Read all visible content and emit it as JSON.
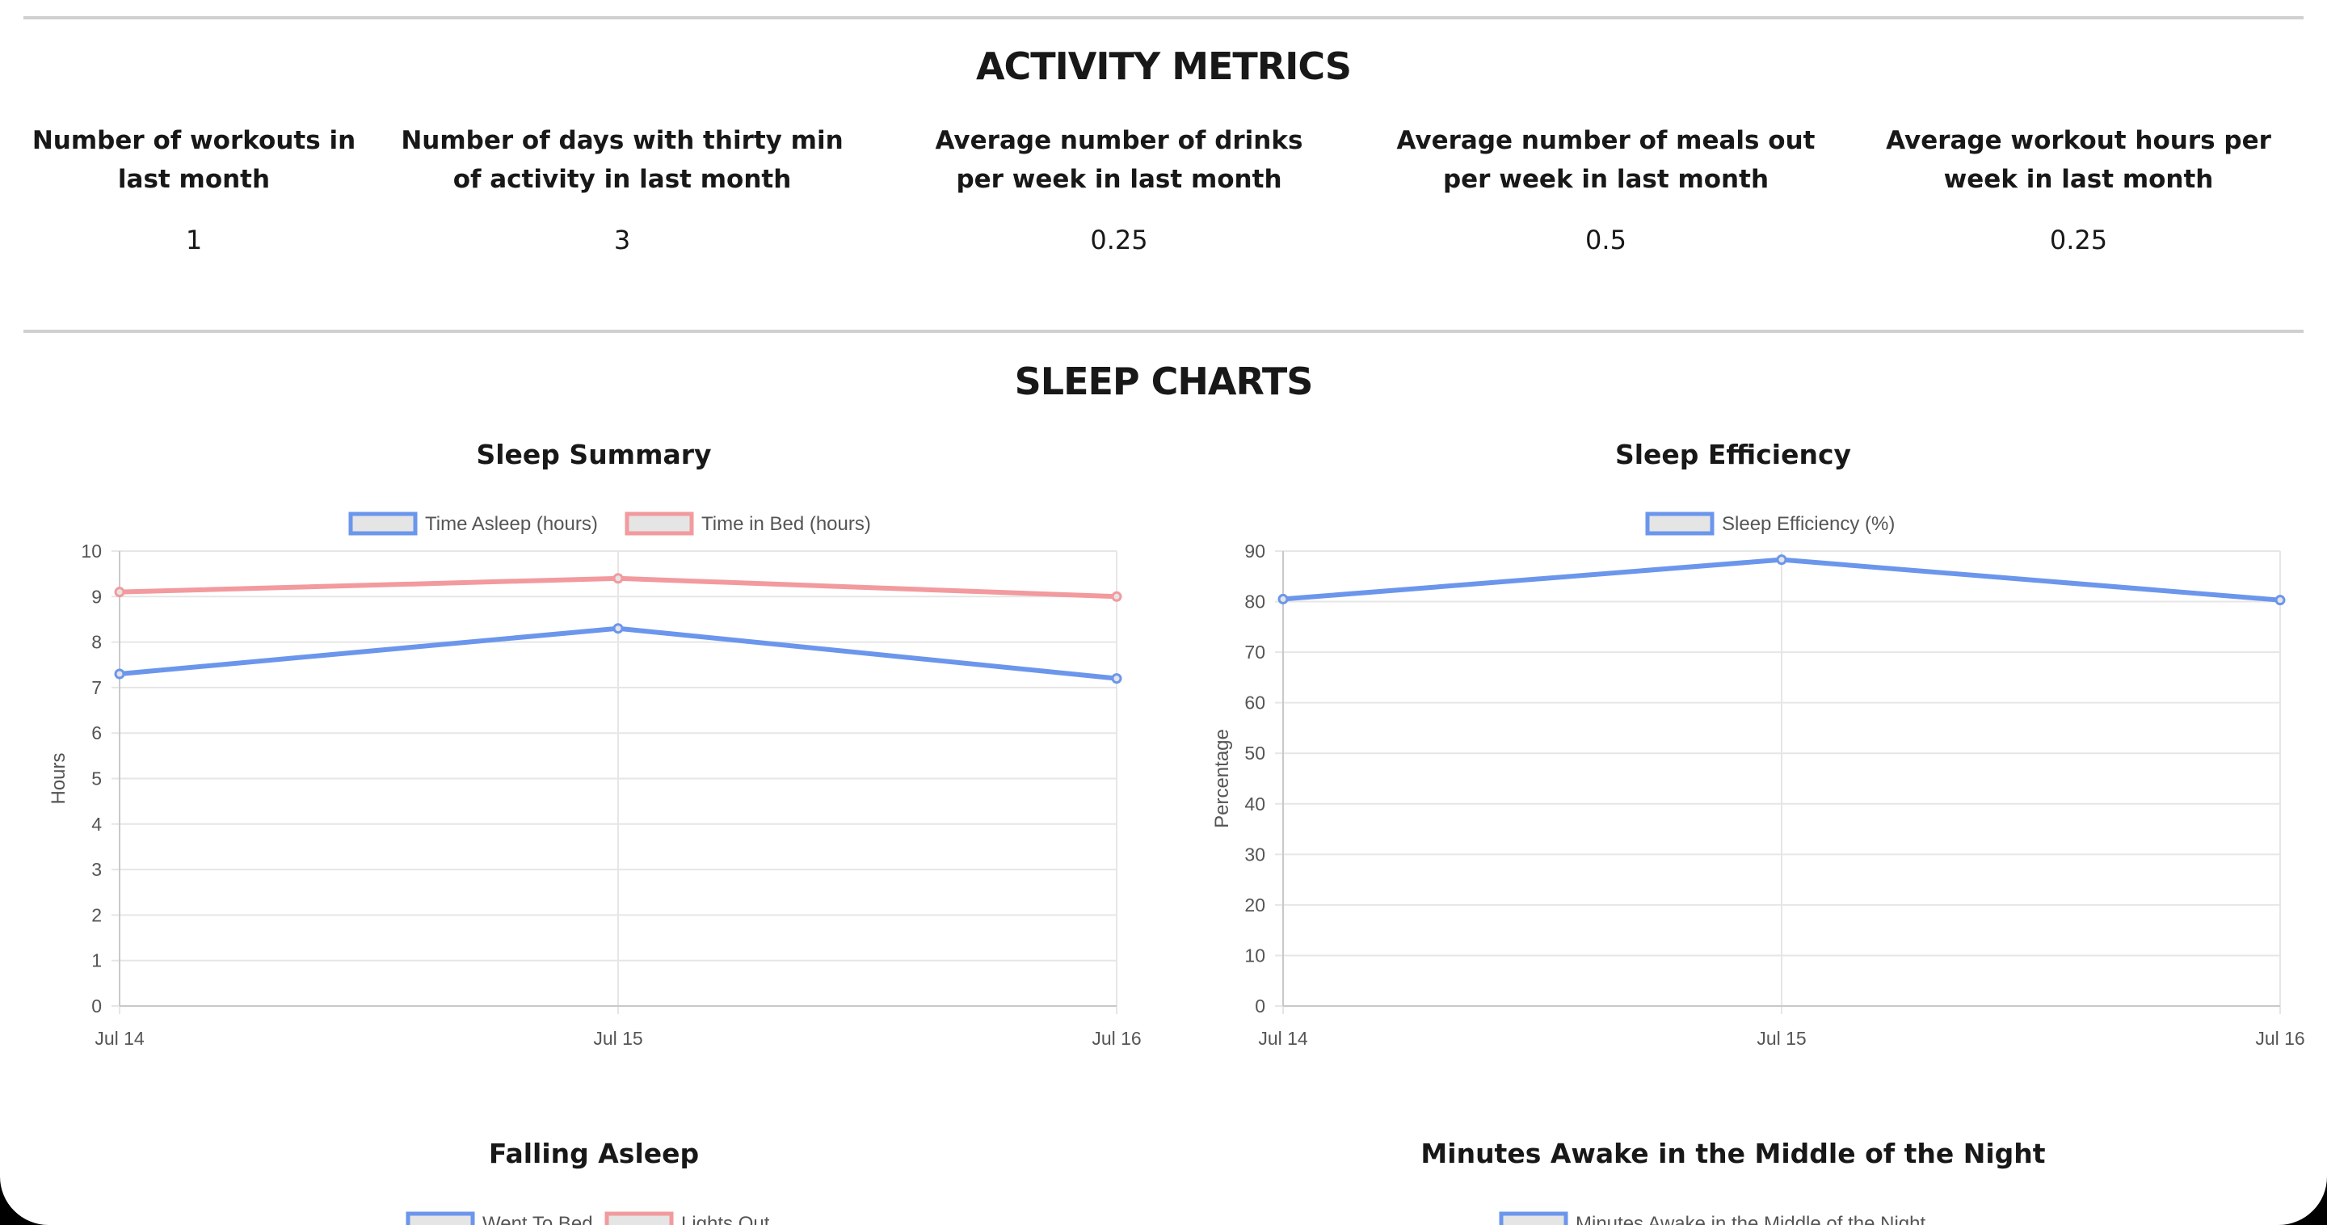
{
  "activity": {
    "title": "ACTIVITY METRICS",
    "metrics": [
      {
        "label": "Number of workouts in last month",
        "value": "1"
      },
      {
        "label": "Number of days with thirty min of activity in last month",
        "value": "3"
      },
      {
        "label": "Average number of drinks per week in last month",
        "value": "0.25"
      },
      {
        "label": "Average number of meals out per week in last month",
        "value": "0.5"
      },
      {
        "label": "Average workout hours per week in last month",
        "value": "0.25"
      }
    ]
  },
  "sleep": {
    "title": "SLEEP CHARTS",
    "falling_asleep": {
      "title": "Falling Asleep",
      "legend": [
        "Went To Bed",
        "Lights Out"
      ]
    },
    "minutes_awake": {
      "title": "Minutes Awake in the Middle of the Night",
      "legend": [
        "Minutes Awake in the Middle of the Night"
      ]
    }
  },
  "colors": {
    "blue": "#6b96ec",
    "red": "#f29a9e",
    "legend_fill": "#e5e5e5",
    "grid": "#e6e6e6",
    "axis": "#c9c9c9",
    "text": "#181818",
    "tick_text": "#555555"
  },
  "chart_data": [
    {
      "type": "line",
      "title": "Sleep Summary",
      "x": [
        "Jul 14",
        "Jul 15",
        "Jul 16"
      ],
      "ylabel": "Hours",
      "ylim": [
        0,
        10
      ],
      "yticks": [
        0,
        1,
        2,
        3,
        4,
        5,
        6,
        7,
        8,
        9,
        10
      ],
      "grid": true,
      "legend_position": "top",
      "series": [
        {
          "name": "Time Asleep (hours)",
          "values": [
            7.3,
            8.3,
            7.2
          ],
          "color": "#6b96ec"
        },
        {
          "name": "Time in Bed (hours)",
          "values": [
            9.1,
            9.4,
            9.0
          ],
          "color": "#f29a9e"
        }
      ]
    },
    {
      "type": "line",
      "title": "Sleep Efficiency",
      "x": [
        "Jul 14",
        "Jul 15",
        "Jul 16"
      ],
      "ylabel": "Percentage",
      "ylim": [
        0,
        90
      ],
      "yticks": [
        0,
        10,
        20,
        30,
        40,
        50,
        60,
        70,
        80,
        90
      ],
      "grid": true,
      "legend_position": "top",
      "series": [
        {
          "name": "Sleep Efficiency (%)",
          "values": [
            80.5,
            88.3,
            80.3
          ],
          "color": "#6b96ec"
        }
      ]
    }
  ]
}
